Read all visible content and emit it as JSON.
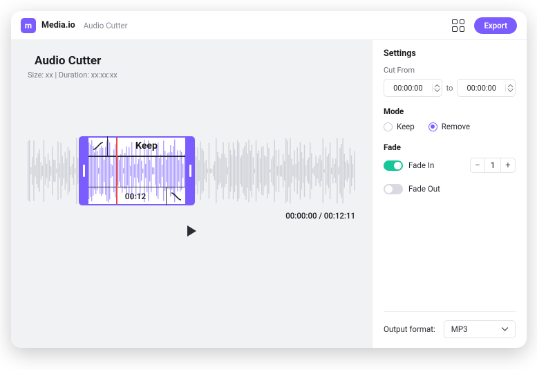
{
  "header": {
    "brand": "Media.io",
    "breadcrumb": "Audio Cutter",
    "export_label": "Export"
  },
  "main": {
    "title": "Audio Cutter",
    "meta_size_label": "Size: xx",
    "meta_duration_label": "Duration: xx:xx:xx",
    "selection_label": "Keep",
    "selection_time": "00:12",
    "current_time": "00:00:00",
    "total_time": "00:12:11"
  },
  "settings": {
    "heading": "Settings",
    "cut_from_label": "Cut From",
    "time_from": "00:00:00",
    "to_label": "to",
    "time_to": "00:00:00",
    "mode_label": "Mode",
    "mode_keep": "Keep",
    "mode_remove": "Remove",
    "mode_selected": "remove",
    "fade_label": "Fade",
    "fade_in_label": "Fade In",
    "fade_out_label": "Fade Out",
    "fade_in_value": "1",
    "output_format_label": "Output format:",
    "output_format_value": "MP3"
  }
}
